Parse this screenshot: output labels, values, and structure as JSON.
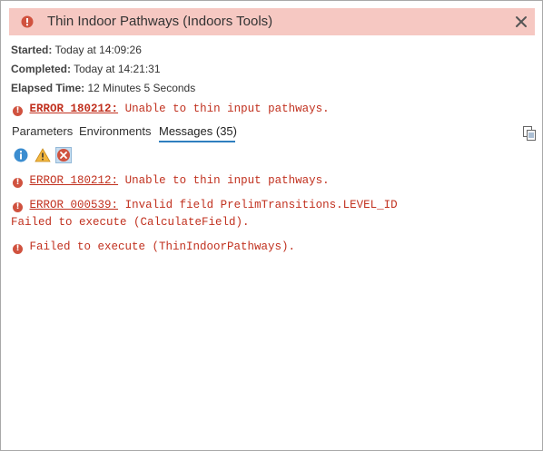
{
  "header": {
    "title": "Thin Indoor Pathways (Indoors Tools)",
    "background_color": "#f6c8c2"
  },
  "summary": {
    "started_label": "Started:",
    "started_value": "Today at 14:09:26",
    "completed_label": "Completed:",
    "completed_value": "Today at 14:21:31",
    "elapsed_label": "Elapsed Time:",
    "elapsed_value": "12 Minutes 5 Seconds"
  },
  "top_error": {
    "code": "ERROR 180212:",
    "text": "Unable to thin input pathways."
  },
  "tabs": {
    "parameters": "Parameters",
    "environments": "Environments",
    "messages": "Messages (35)"
  },
  "filters": {
    "info_icon": "info-icon",
    "warning_icon": "warning-icon",
    "error_icon": "error-icon",
    "selected": "error"
  },
  "messages": [
    {
      "code": "ERROR 180212:",
      "text": "Unable to thin input pathways."
    },
    {
      "code": "ERROR 000539:",
      "text": "Invalid field PrelimTransitions.LEVEL_ID",
      "continuation": "Failed to execute (CalculateField)."
    },
    {
      "text": "Failed to execute (ThinIndoorPathways)."
    }
  ],
  "colors": {
    "error_text": "#c1311f",
    "accent": "#2f7fbf"
  }
}
